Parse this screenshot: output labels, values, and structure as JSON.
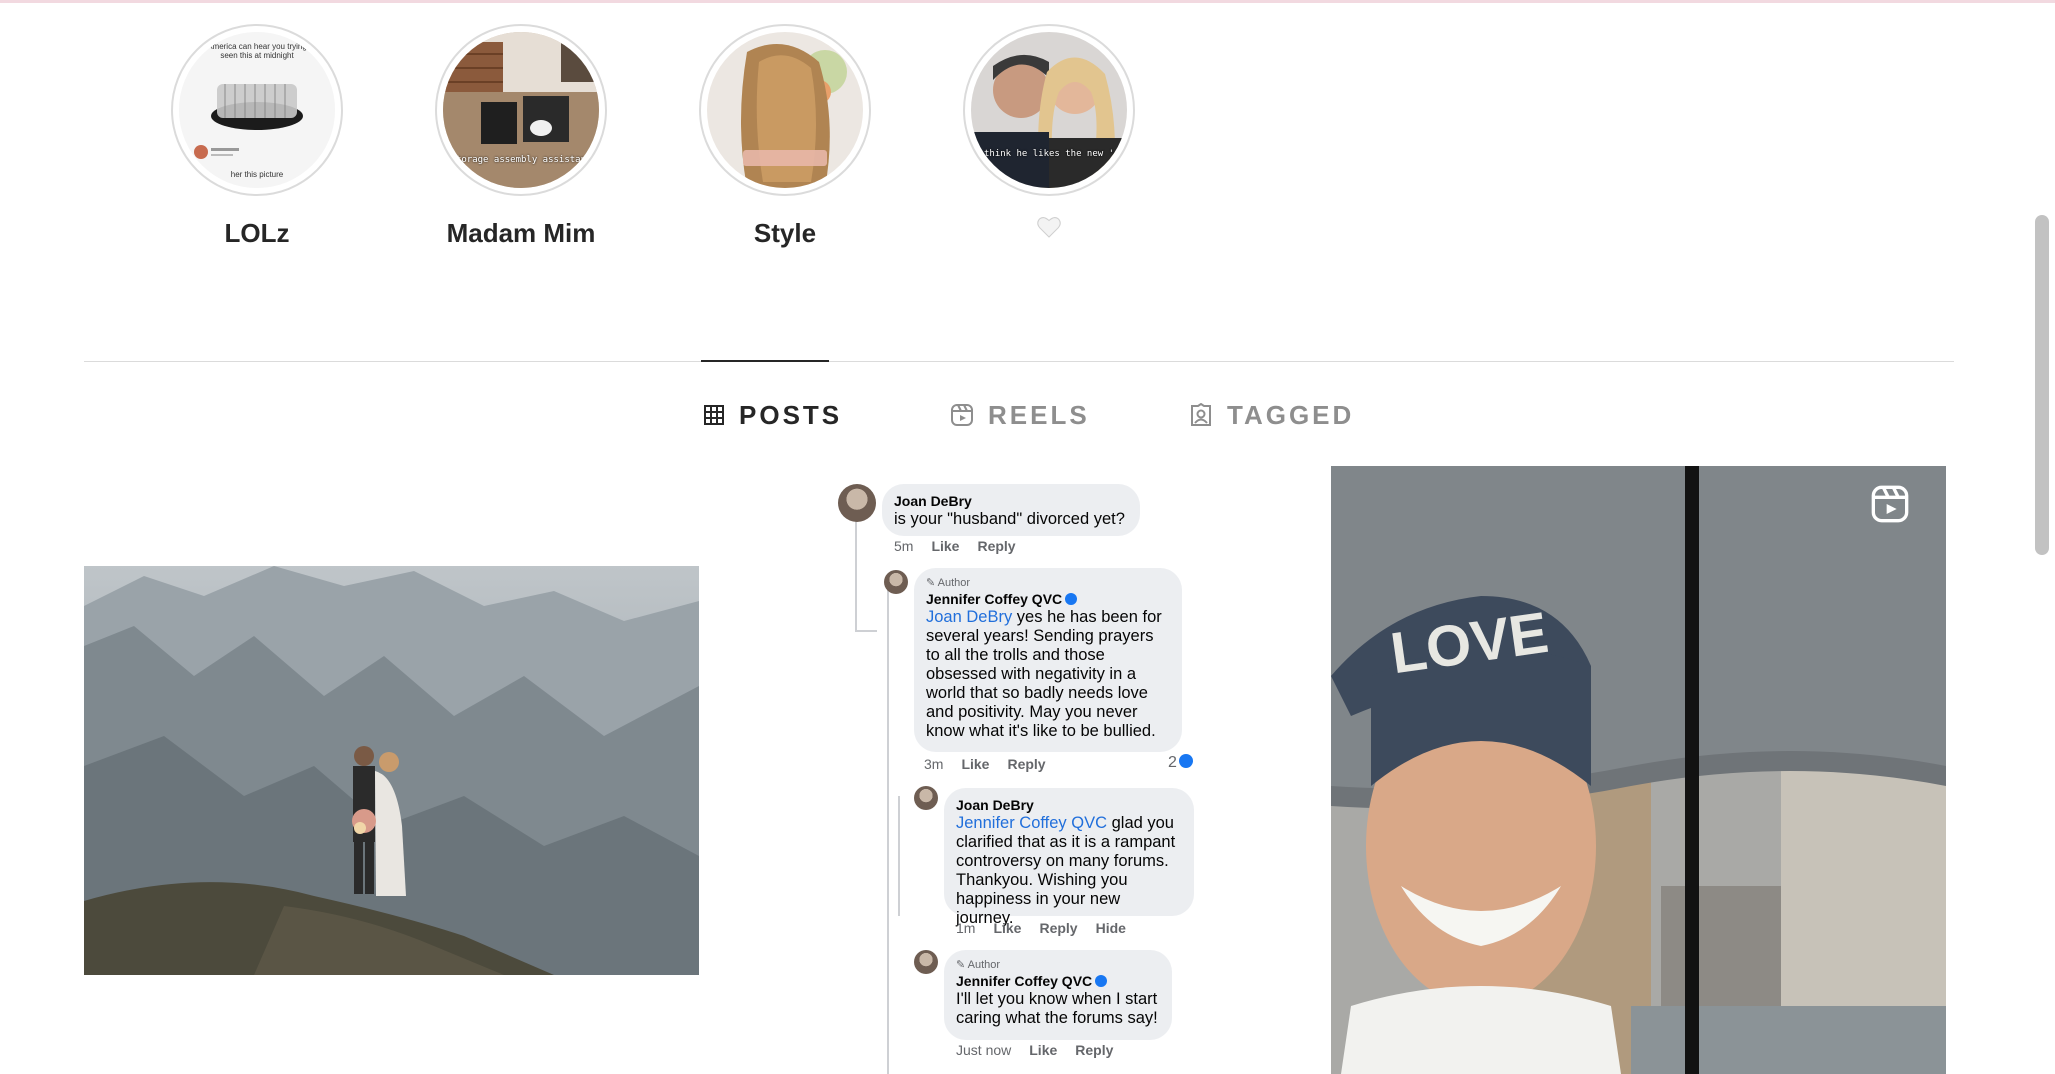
{
  "highlights": [
    {
      "label": "LOLz",
      "thumb_text": ""
    },
    {
      "label": "Madam Mim",
      "thumb_text": "Storage assembly assistant"
    },
    {
      "label": "Style",
      "thumb_text": ""
    },
    {
      "label": "",
      "thumb_text": "I think he likes the new 'do"
    }
  ],
  "highlight_1_snippets": {
    "top": "America can hear you trying\nseen this at midnight",
    "bottom": "her this picture"
  },
  "tabs": [
    {
      "label": "POSTS",
      "icon": "grid-icon",
      "active": true
    },
    {
      "label": "REELS",
      "icon": "reels-icon",
      "active": false
    },
    {
      "label": "TAGGED",
      "icon": "tagged-icon",
      "active": false
    }
  ],
  "comments": {
    "c1": {
      "name": "Joan DeBry",
      "text": "is your \"husband\" divorced yet?",
      "time": "5m",
      "like": "Like",
      "reply": "Reply"
    },
    "c2": {
      "tag": "Author",
      "name": "Jennifer Coffey QVC",
      "mention": "Joan DeBry",
      "text": " yes he has been for several years! Sending prayers to all the trolls and those obsessed with negativity in a world that so badly needs love and positivity. May you never know what it's like to be bullied.",
      "time": "3m",
      "like": "Like",
      "reply": "Reply",
      "reactions": "2"
    },
    "c3": {
      "name": "Joan DeBry",
      "mention": "Jennifer Coffey QVC",
      "text": "  glad you clarified that as it is a rampant controversy on many forums. Thankyou.  Wishing you happiness in your new journey.",
      "time": "1m",
      "like": "Like",
      "reply": "Reply",
      "hide": "Hide"
    },
    "c4": {
      "tag": "Author",
      "name": "Jennifer Coffey QVC",
      "text": "I'll let you know when I start caring what the forums say!",
      "time": "Just now",
      "like": "Like",
      "reply": "Reply"
    }
  },
  "post3": {
    "cap_text": "LOVE",
    "icon": "reel-badge-icon"
  },
  "colors": {
    "accent_blue": "#216fdb",
    "tab_active": "#262626",
    "tab_inactive": "#8e8e8e"
  }
}
